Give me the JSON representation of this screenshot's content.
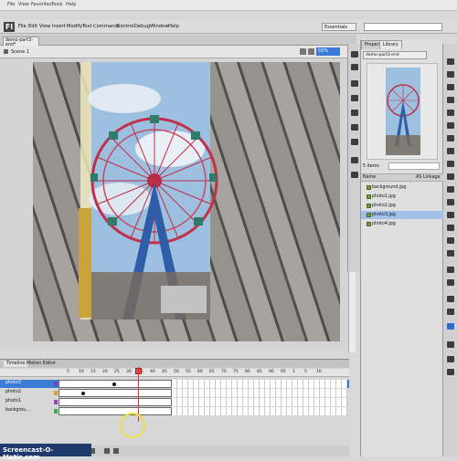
{
  "os_menu": [
    "File",
    "View",
    "Favorites",
    "Tools",
    "Help"
  ],
  "menu": [
    "File",
    "Edit",
    "View",
    "Insert",
    "Modify",
    "Text",
    "Commands",
    "Control",
    "Debug",
    "Window",
    "Help"
  ],
  "workspace": "Essentials",
  "document_tab": "demo-part3-end*",
  "scene_label": "Scene 1",
  "zoom": "55%",
  "panel_tabs": [
    "Properties",
    "Library"
  ],
  "library_document": "demo-part3-end",
  "library_count": "5 items",
  "library_columns": {
    "name": "Name",
    "linkage": "AS Linkage"
  },
  "library_items": [
    {
      "name": "background.jpg",
      "selected": false
    },
    {
      "name": "photo1.jpg",
      "selected": false
    },
    {
      "name": "photo2.jpg",
      "selected": false
    },
    {
      "name": "photo3.jpg",
      "selected": true
    },
    {
      "name": "photo4.jpg",
      "selected": false
    }
  ],
  "timeline_tabs": [
    "Timeline",
    "Motion Editor"
  ],
  "frame_numbers": [
    "5",
    "10",
    "15",
    "20",
    "25",
    "30",
    "35",
    "40",
    "45",
    "50",
    "55",
    "60",
    "65",
    "70",
    "75",
    "80",
    "85",
    "90",
    "95",
    "1",
    "5",
    "10"
  ],
  "layers": [
    {
      "name": "photo3",
      "color": "#7a40c0",
      "selected": true
    },
    {
      "name": "photo2",
      "color": "#e0a020",
      "selected": false
    },
    {
      "name": "photo1",
      "color": "#9a40c0",
      "selected": false
    },
    {
      "name": "backgrou...",
      "color": "#30b040",
      "selected": false
    }
  ],
  "watermark": "Screencast-O-Matic.com"
}
